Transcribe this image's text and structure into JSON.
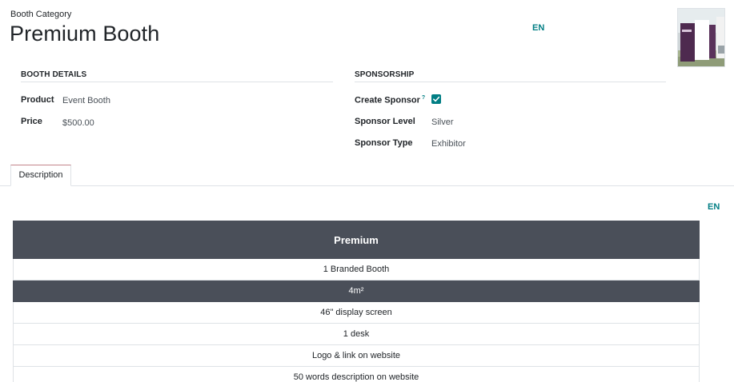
{
  "header": {
    "model_label": "Booth Category",
    "title": "Premium Booth",
    "language_badge": "EN"
  },
  "booth_details": {
    "section_title": "BOOTH DETAILS",
    "product_label": "Product",
    "product_value": "Event Booth",
    "price_label": "Price",
    "price_value": "$500.00"
  },
  "sponsorship": {
    "section_title": "SPONSORSHIP",
    "create_sponsor_label": "Create Sponsor",
    "create_sponsor_help": "?",
    "create_sponsor_checked": true,
    "sponsor_level_label": "Sponsor Level",
    "sponsor_level_value": "Silver",
    "sponsor_type_label": "Sponsor Type",
    "sponsor_type_value": "Exhibitor"
  },
  "tabs": [
    {
      "label": "Description",
      "active": true
    }
  ],
  "description": {
    "language_badge": "EN",
    "table_header": "Premium",
    "rows": [
      {
        "text": "1 Branded Booth",
        "dark": false
      },
      {
        "text": "4m²",
        "dark": true
      },
      {
        "text": "46\" display screen",
        "dark": false
      },
      {
        "text": "1 desk",
        "dark": false
      },
      {
        "text": "Logo & link on website",
        "dark": false
      },
      {
        "text": "50 words description on website",
        "dark": false
      }
    ]
  },
  "colors": {
    "accent": "#017e84",
    "table_header_bg": "#4a4f59",
    "tab_top_border": "#c3848a"
  }
}
